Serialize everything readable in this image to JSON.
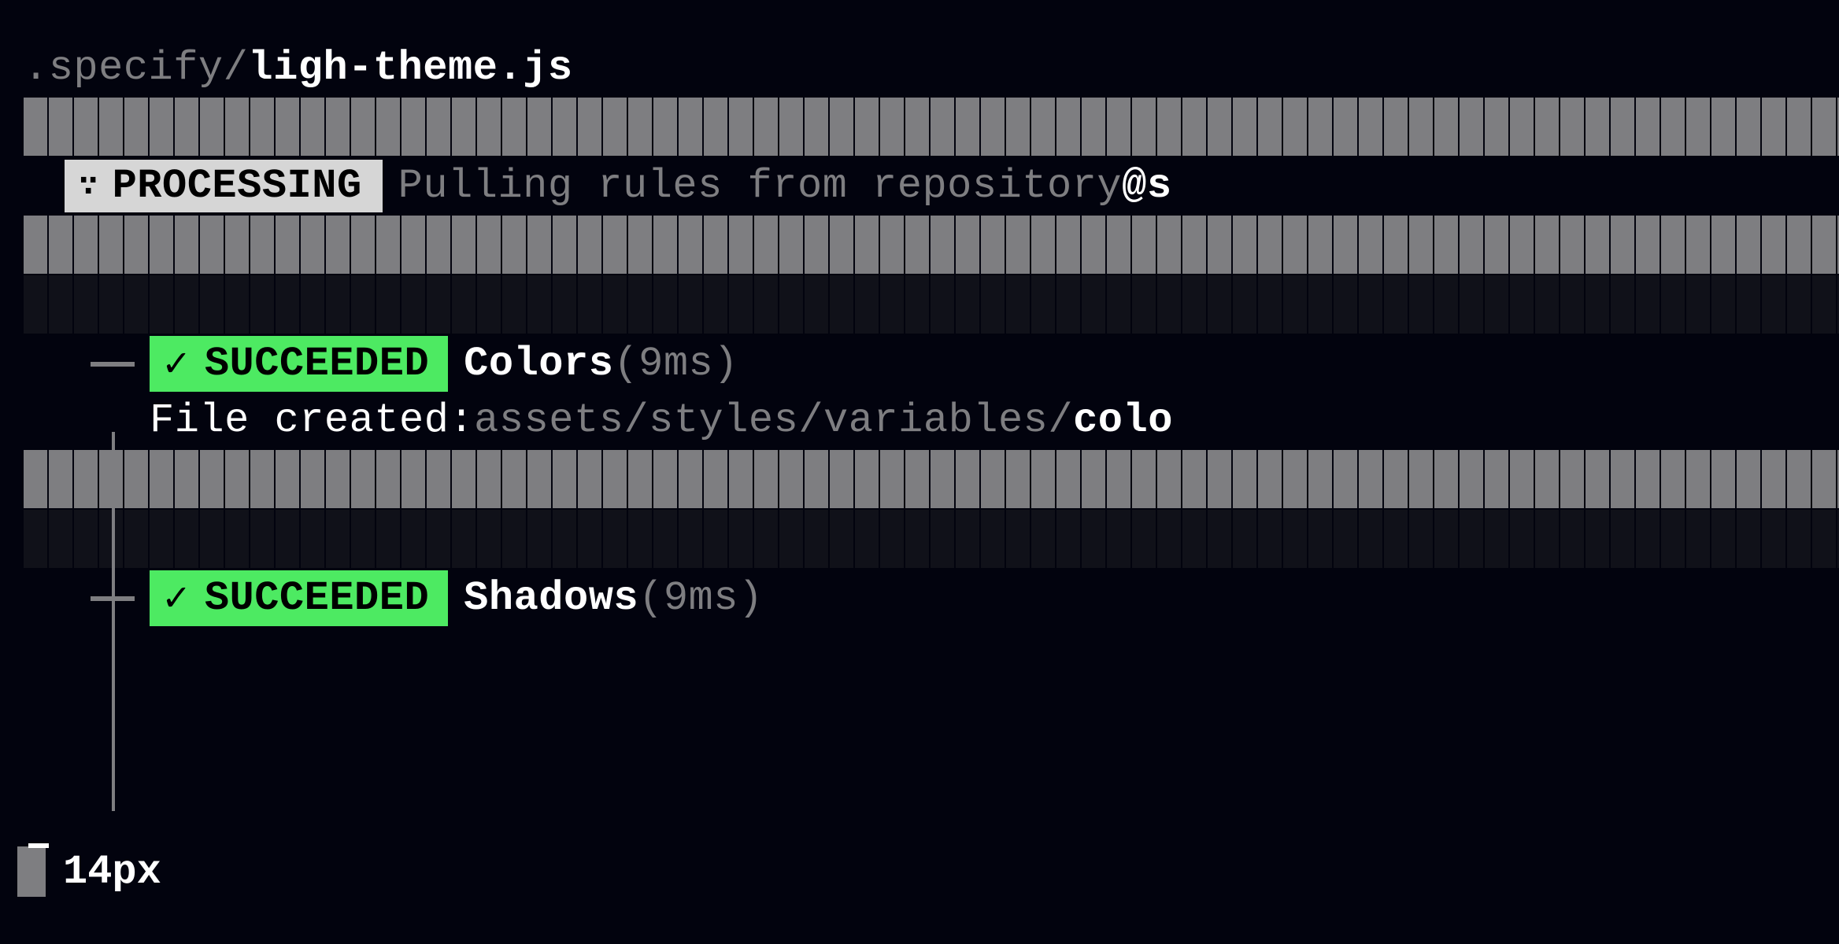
{
  "header": {
    "path_prefix": ".specify/",
    "filename": "ligh-theme.js"
  },
  "processing": {
    "badge_icon": "∵",
    "badge_label": "PROCESSING",
    "message_prefix": "Pulling rules from repository ",
    "message_suffix": "@s"
  },
  "tasks": [
    {
      "badge_icon": "✓",
      "badge_label": "SUCCEEDED",
      "name": "Colors",
      "duration": "(9ms)",
      "file_label": "File created: ",
      "file_path": "assets/styles/variables/",
      "file_name_partial": "colo"
    },
    {
      "badge_icon": "✓",
      "badge_label": "SUCCEEDED",
      "name": "Shadows",
      "duration": "(9ms)"
    }
  ],
  "footer": {
    "size_label": "14px"
  },
  "colors": {
    "bg": "#02030e",
    "dim": "#7e7e81",
    "success": "#4dea62",
    "processing_bg": "#d6d6d6"
  }
}
